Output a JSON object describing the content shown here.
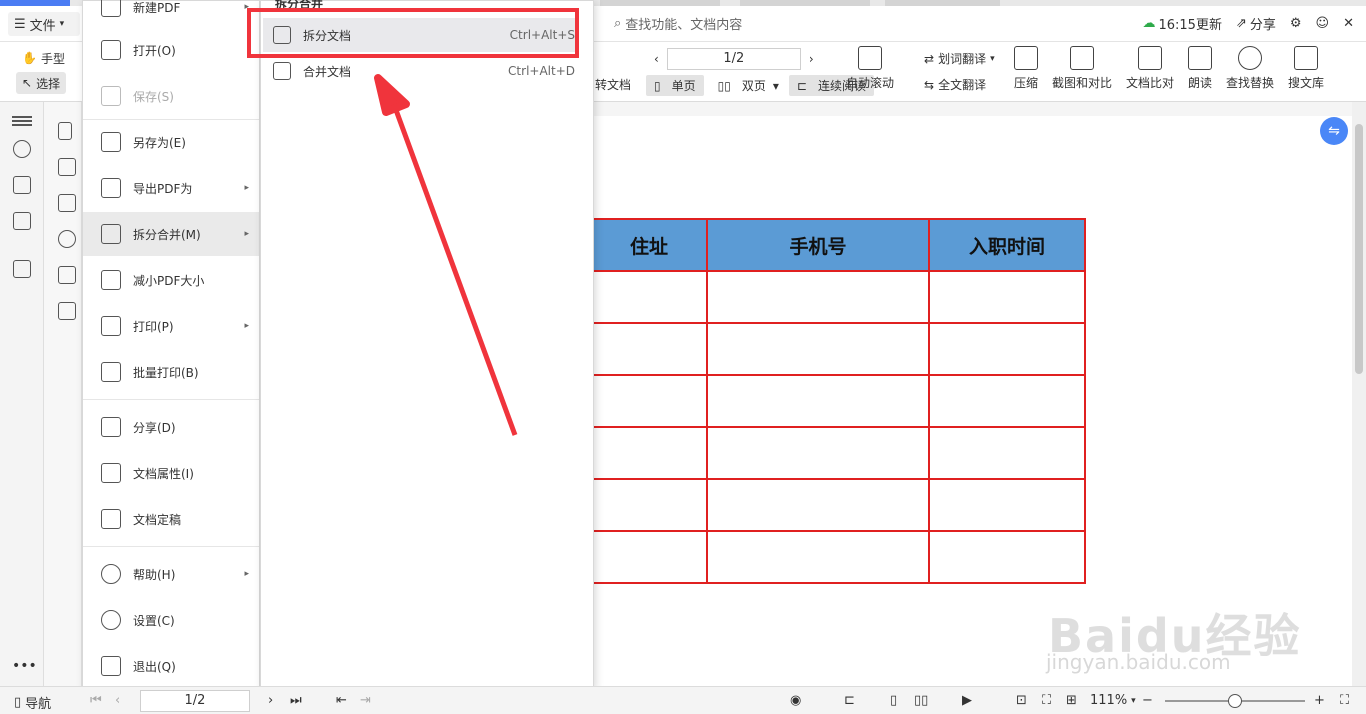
{
  "menubar": {
    "file_label": "文件",
    "search_placeholder": "查找功能、文档内容",
    "sync_time": "16:15更新",
    "share_label": "分享"
  },
  "ribbon": {
    "hand_label": "手型",
    "select_label": "选择",
    "page_value": "1/2",
    "convert_label": "转文档",
    "single_page": "单页",
    "double_page": "双页",
    "continuous": "连续阅读",
    "auto_scroll": "自动滚动",
    "word_translate": "划词翻译",
    "full_translate": "全文翻译",
    "compress": "压缩",
    "screenshot_compare": "截图和对比",
    "doc_compare": "文档比对",
    "read_aloud": "朗读",
    "find_replace": "查找替换",
    "search_library": "搜文库"
  },
  "file_menu": {
    "items": [
      {
        "label": "新建PDF",
        "icon": "new-pdf-icon"
      },
      {
        "label": "打开(O)",
        "icon": "folder-icon"
      },
      {
        "label": "保存(S)",
        "icon": "save-icon"
      },
      {
        "label": "另存为(E)",
        "icon": "save-as-icon"
      },
      {
        "label": "导出PDF为",
        "icon": "export-pdf-icon"
      },
      {
        "label": "拆分合并(M)",
        "icon": "split-merge-icon"
      },
      {
        "label": "减小PDF大小",
        "icon": "compress-icon"
      },
      {
        "label": "打印(P)",
        "icon": "printer-icon"
      },
      {
        "label": "批量打印(B)",
        "icon": "batch-print-icon"
      },
      {
        "label": "分享(D)",
        "icon": "share-icon"
      },
      {
        "label": "文档属性(I)",
        "icon": "properties-icon"
      },
      {
        "label": "文档定稿",
        "icon": "finalize-icon"
      },
      {
        "label": "帮助(H)",
        "icon": "help-icon"
      },
      {
        "label": "设置(C)",
        "icon": "settings-icon"
      },
      {
        "label": "退出(Q)",
        "icon": "exit-icon"
      }
    ]
  },
  "submenu": {
    "heading": "拆分合并",
    "split_label": "拆分文档",
    "split_shortcut": "Ctrl+Alt+S",
    "merge_label": "合并文档",
    "merge_shortcut": "Ctrl+Alt+D"
  },
  "table": {
    "headers": [
      "住址",
      "手机号",
      "入职时间"
    ],
    "row_count": 6
  },
  "statusbar": {
    "nav_label": "导航",
    "page_value": "1/2",
    "zoom": "111%"
  },
  "watermark": {
    "text": "Baidu经验",
    "url": "jingyan.baidu.com"
  },
  "colors": {
    "accent": "#4b7cf3",
    "table_header": "#5b9bd5",
    "table_border": "#e02020",
    "annotation_red": "#f0343c"
  }
}
